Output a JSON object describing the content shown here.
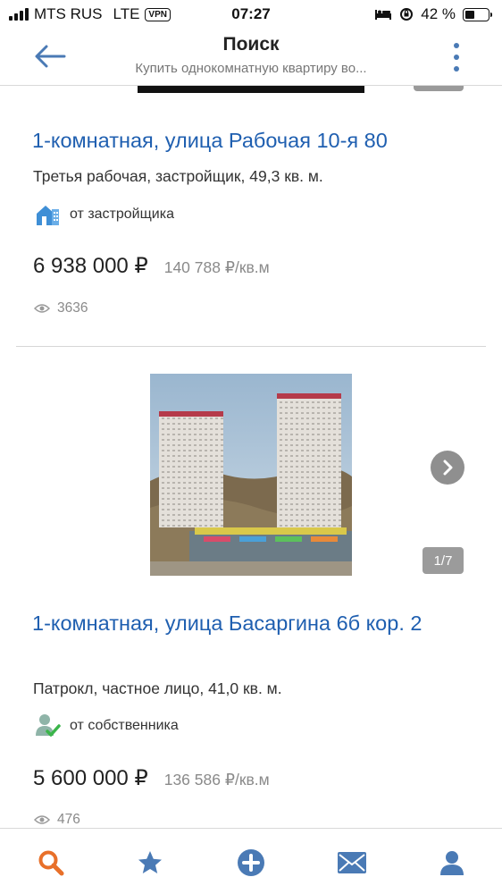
{
  "status_bar": {
    "carrier": "MTS RUS",
    "network": "LTE",
    "vpn": "VPN",
    "time": "07:27",
    "battery": "42 %",
    "battery_level": 0.42
  },
  "header": {
    "title": "Поиск",
    "subtitle": "Купить однокомнатную квартиру во..."
  },
  "listings": [
    {
      "title": "1-комнатная, улица Рабочая 10-я 80",
      "description": "Третья рабочая, застройщик, 49,3 кв. м.",
      "seller": "от застройщика",
      "seller_icon": "developer-house-icon",
      "price": "6 938 000 ₽",
      "price_per_m2": "140 788 ₽/кв.м",
      "views": "3636"
    },
    {
      "title": "1-комнатная, улица Басаргина 6б кор. 2",
      "description": "Патрокл, частное лицо, 41,0 кв. м.",
      "seller": "от собственника",
      "seller_icon": "verified-owner-icon",
      "price": "5 600 000 ₽",
      "price_per_m2": "136 586 ₽/кв.м",
      "views": "476",
      "photo_counter": "1/7"
    }
  ],
  "tabbar": {
    "items": [
      "search-icon",
      "star-icon",
      "add-icon",
      "mail-icon",
      "profile-icon"
    ],
    "active_color": "#e8702a",
    "inactive_color": "#4a7ab5"
  },
  "colors": {
    "link": "#1f5fb0",
    "accent": "#4a7ab5"
  }
}
